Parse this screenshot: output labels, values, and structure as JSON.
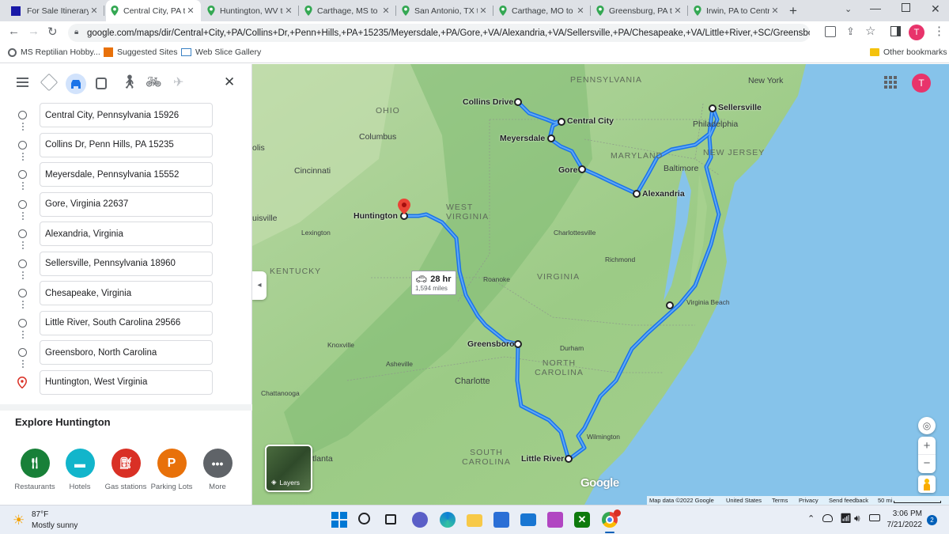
{
  "tabs": [
    {
      "title": "For Sale Itinerary",
      "active": false
    },
    {
      "title": "Central City, PA to",
      "active": true
    },
    {
      "title": "Huntington, WV to",
      "active": false
    },
    {
      "title": "Carthage, MS to",
      "active": false
    },
    {
      "title": "San Antonio, TX to",
      "active": false
    },
    {
      "title": "Carthage, MO to",
      "active": false
    },
    {
      "title": "Greensburg, PA to",
      "active": false
    },
    {
      "title": "Irwin, PA to Centr",
      "active": false
    }
  ],
  "address_bar": {
    "url": "google.com/maps/dir/Central+City,+PA/Collins+Dr,+Penn+Hills,+PA+15235/Meyersdale,+PA/Gore,+VA/Alexandria,+VA/Sellersville,+PA/Chesapeake,+VA/Little+River,+SC/Greensboro,+..."
  },
  "bookmarks": {
    "items": [
      "MS Reptilian Hobby...",
      "Suggested Sites",
      "Web Slice Gallery"
    ],
    "other": "Other bookmarks"
  },
  "profile_initial": "T",
  "directions": {
    "stops": [
      "Central City, Pennsylvania 15926",
      "Collins Dr, Penn Hills, PA 15235",
      "Meyersdale, Pennsylvania 15552",
      "Gore, Virginia 22637",
      "Alexandria, Virginia",
      "Sellersville, Pennsylvania 18960",
      "Chesapeake, Virginia",
      "Little River, South Carolina 29566",
      "Greensboro, North Carolina",
      "Huntington, West Virginia"
    ],
    "explore_title": "Explore Huntington",
    "explore_items": [
      "Restaurants",
      "Hotels",
      "Gas stations",
      "Parking Lots",
      "More"
    ]
  },
  "map": {
    "route_time": "28 hr",
    "route_distance": "1,594 miles",
    "layers_label": "Layers",
    "google_logo": "Google",
    "footer": [
      "Map data ©2022 Google",
      "United States",
      "Terms",
      "Privacy",
      "Send feedback",
      "50 mi"
    ],
    "state_labels": [
      "PENNSYLVANIA",
      "OHIO",
      "WEST VIRGINIA",
      "MARYLAND",
      "NEW JERSEY",
      "KENTUCKY",
      "VIRGINIA",
      "NORTH CAROLINA",
      "SOUTH CAROLINA"
    ],
    "city_labels": [
      "New York",
      "Philadelphia",
      "Baltimore",
      "Columbus",
      "Cincinnati",
      "Lexington",
      "Charlottesville",
      "Richmond",
      "Roanoke",
      "Knoxville",
      "Asheville",
      "Durham",
      "Charlotte",
      "Chattanooga",
      "Wilmington",
      "Virginia Beach",
      "olis",
      "uisville",
      "tlanta"
    ],
    "stop_labels": [
      "Collins Drive",
      "Central City",
      "Meyersdale",
      "Gore",
      "Alexandria",
      "Sellersville",
      "Huntington",
      "Greensboro",
      "Little River"
    ]
  },
  "taskbar": {
    "weather_temp": "87°F",
    "weather_desc": "Mostly sunny",
    "time": "3:06 PM",
    "date": "7/21/2022",
    "notification_count": "2"
  }
}
